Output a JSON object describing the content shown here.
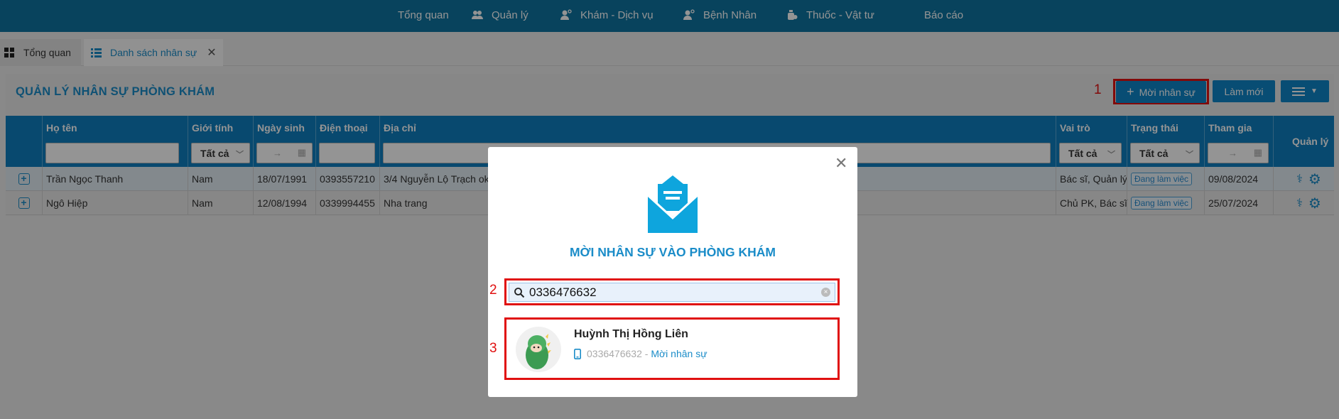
{
  "nav": {
    "items": [
      {
        "label": "Tổng quan",
        "icon": "dashboard-icon"
      },
      {
        "label": "Quản lý",
        "icon": "users-icon"
      },
      {
        "label": "Khám - Dịch vụ",
        "icon": "doctor-icon"
      },
      {
        "label": "Bệnh Nhân",
        "icon": "patient-icon"
      },
      {
        "label": "Thuốc - Vật tư",
        "icon": "medicine-icon"
      },
      {
        "label": "Báo cáo",
        "icon": "report-icon"
      }
    ]
  },
  "tabs": {
    "overview": "Tổng quan",
    "active": "Danh sách nhân sự",
    "close": "✕"
  },
  "page": {
    "title": "QUẢN LÝ NHÂN SỰ PHÒNG KHÁM",
    "invite_button": "Mời nhân sự",
    "invite_plus": "+",
    "refresh_button": "Làm mới"
  },
  "markers": {
    "m1": "1",
    "m2": "2",
    "m3": "3"
  },
  "table": {
    "headers": {
      "name": "Họ tên",
      "gender": "Giới tính",
      "dob": "Ngày sinh",
      "phone": "Điện thoại",
      "address": "Địa chỉ",
      "role": "Vai trò",
      "status": "Trạng thái",
      "joined": "Tham gia",
      "manage": "Quản lý"
    },
    "filters": {
      "gender": "Tất cả",
      "role": "Tất cả",
      "status": "Tất cả",
      "date_arrow": "→"
    },
    "rows": [
      {
        "name": "Trần Ngọc Thanh",
        "gender": "Nam",
        "dob": "18/07/1991",
        "phone": "0393557210",
        "address": "3/4 Nguyễn Lộ Trạch ok",
        "role": "Bác sĩ, Quản lý",
        "status": "Đang làm việc",
        "joined": "09/08/2024"
      },
      {
        "name": "Ngô Hiệp",
        "gender": "Nam",
        "dob": "12/08/1994",
        "phone": "0339994455",
        "address": "Nha trang",
        "role": "Chủ PK, Bác sĩ",
        "status": "Đang làm việc",
        "joined": "25/07/2024"
      }
    ]
  },
  "modal": {
    "title": "MỜI NHÂN SỰ VÀO PHÒNG KHÁM",
    "close": "✕",
    "search_value": "0336476632",
    "clear": "×",
    "result": {
      "name": "Huỳnh Thị Hồng Liên",
      "phone": "0336476632",
      "separator": " - ",
      "action": "Mời nhân sự"
    }
  },
  "colors": {
    "primary": "#0e7fc0",
    "nav": "#0e74a0",
    "highlight": "#e01010",
    "title": "#1a8cc8"
  }
}
